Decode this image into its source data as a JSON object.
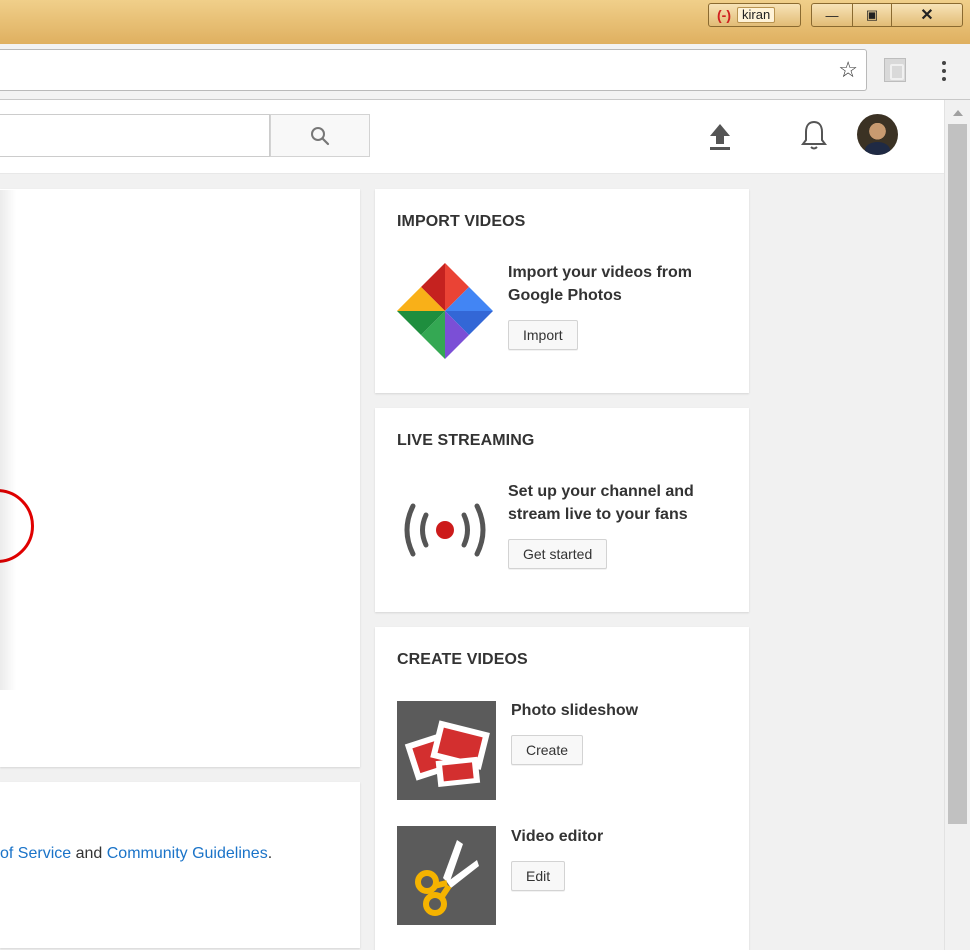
{
  "window": {
    "user_name": "kiran",
    "user_glyph": "(-)",
    "minimize_glyph": "—",
    "maximize_glyph": "▣",
    "close_glyph": "✕"
  },
  "browser": {
    "star_glyph": "☆"
  },
  "import": {
    "title": "IMPORT VIDEOS",
    "description_line1": "Import your videos from",
    "description_line2": "Google Photos",
    "button": "Import"
  },
  "live": {
    "title": "LIVE STREAMING",
    "description_line1": "Set up your channel and",
    "description_line2": "stream live to your fans",
    "button": "Get started"
  },
  "create": {
    "title": "CREATE VIDEOS",
    "slideshow_label": "Photo slideshow",
    "slideshow_button": "Create",
    "editor_label": "Video editor",
    "editor_button": "Edit"
  },
  "terms": {
    "prefix": "of Service",
    "conjunction": " and ",
    "guidelines": "Community Guidelines",
    "suffix": "."
  },
  "colors": {
    "link": "#1a73c8",
    "record_red": "#e00000"
  }
}
